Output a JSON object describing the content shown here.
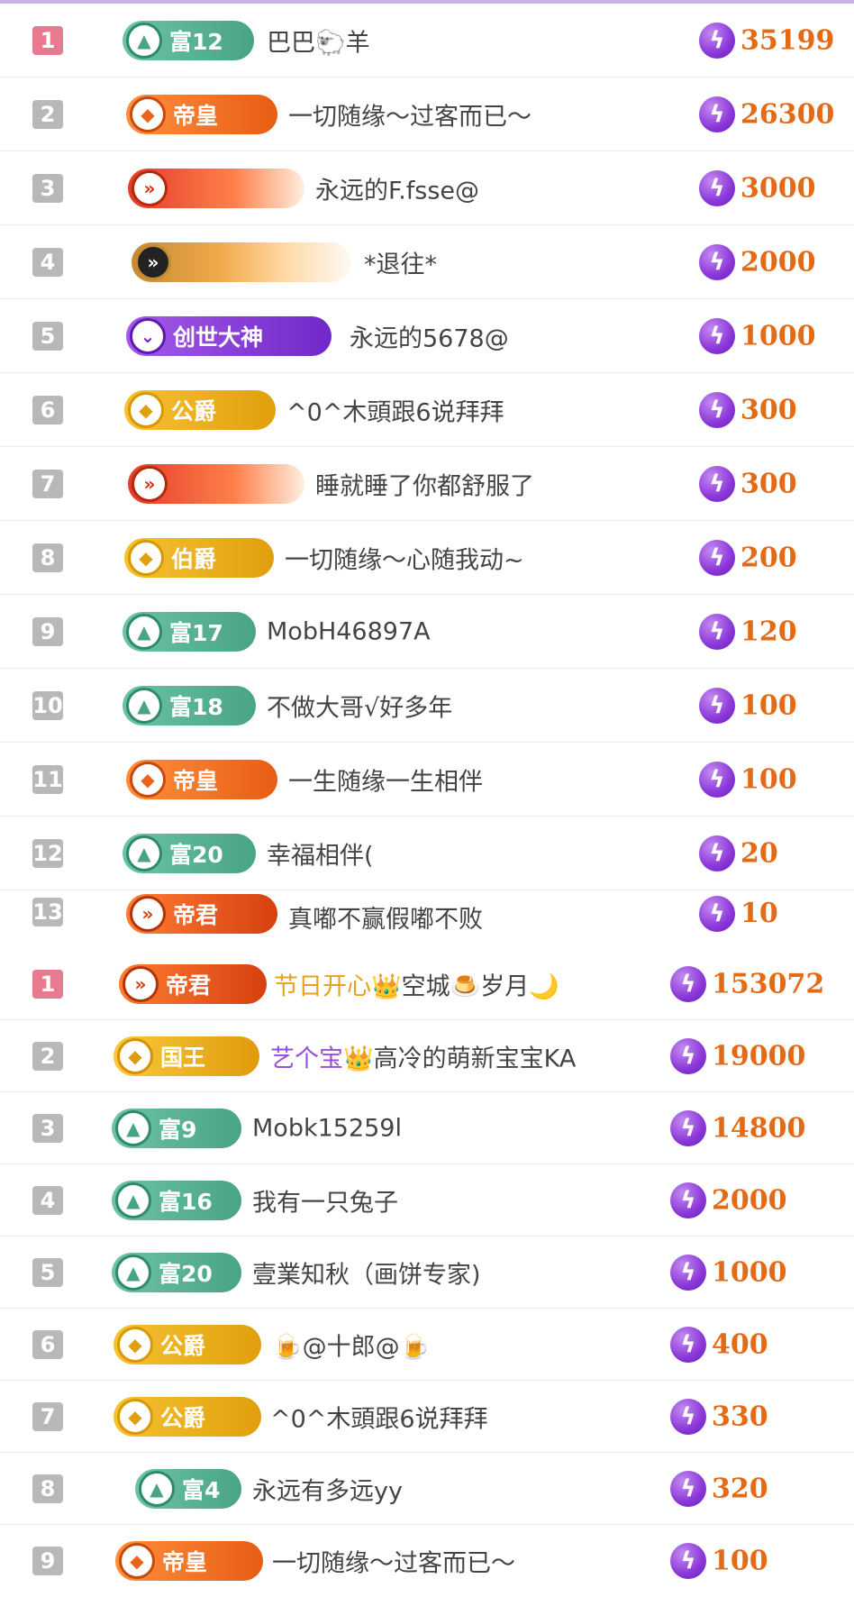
{
  "list1": [
    {
      "rank": "1",
      "badge": "富12",
      "name": "巴巴🐑羊",
      "value": "35199"
    },
    {
      "rank": "2",
      "badge": "帝皇",
      "name": "一切随缘～过客而已～",
      "value": "26300"
    },
    {
      "rank": "3",
      "badge": "",
      "name": "永远的F.fsse@",
      "value": "3000"
    },
    {
      "rank": "4",
      "badge": "",
      "name": "*退往*",
      "value": "2000"
    },
    {
      "rank": "5",
      "badge": "创世大神",
      "name": "永远的5678@",
      "value": "1000"
    },
    {
      "rank": "6",
      "badge": "公爵",
      "name": "^0^木頭跟6说拜拜",
      "value": "300"
    },
    {
      "rank": "7",
      "badge": "",
      "name": "睡就睡了你都舒服了",
      "value": "300"
    },
    {
      "rank": "8",
      "badge": "伯爵",
      "name": "一切随缘～心随我动~",
      "value": "200"
    },
    {
      "rank": "9",
      "badge": "富17",
      "name": "MobH46897A",
      "value": "120"
    },
    {
      "rank": "10",
      "badge": "富18",
      "name": "不做大哥√好多年",
      "value": "100"
    },
    {
      "rank": "11",
      "badge": "帝皇",
      "name": "一生随缘一生相伴",
      "value": "100"
    },
    {
      "rank": "12",
      "badge": "富20",
      "name": "幸福相伴(",
      "value": "20"
    },
    {
      "rank": "13",
      "badge": "帝君",
      "name": "真嘟不赢假嘟不败",
      "value": "10"
    }
  ],
  "list2": [
    {
      "rank": "1",
      "badge": "帝君",
      "name_hl": "节日开心👑",
      "name": "空城🍮岁月🌙",
      "value": "153072"
    },
    {
      "rank": "2",
      "badge": "国王",
      "name_hl": "艺个宝👑",
      "name": "高冷的萌新宝宝KA",
      "value": "19000"
    },
    {
      "rank": "3",
      "badge": "富9",
      "name": "Mobk15259l",
      "value": "14800"
    },
    {
      "rank": "4",
      "badge": "富16",
      "name": "我有一只兔子",
      "value": "2000"
    },
    {
      "rank": "5",
      "badge": "富20",
      "name": "壹業知秋（画饼专家)",
      "value": "1000"
    },
    {
      "rank": "6",
      "badge": "公爵",
      "name": "🍺@十郎@🍺",
      "value": "400"
    },
    {
      "rank": "7",
      "badge": "公爵",
      "name": "^0^木頭跟6说拜拜",
      "value": "330"
    },
    {
      "rank": "8",
      "badge": "富4",
      "name": "永远有多远yy",
      "value": "320"
    },
    {
      "rank": "9",
      "badge": "帝皇",
      "name": "一切随缘～过客而已～",
      "value": "100"
    }
  ],
  "icons": {
    "coin": "lightning-coin-icon",
    "fu": "triangle-level-icon",
    "emperor": "diamond-emblem-icon",
    "chevron": "double-chevron-icon"
  },
  "colors": {
    "accent": "#e56a16",
    "coin": "#8a36d8",
    "rank_first": "#e87a8f",
    "rank_other": "#b8b8b8",
    "top_border": "#c9b2e6"
  }
}
